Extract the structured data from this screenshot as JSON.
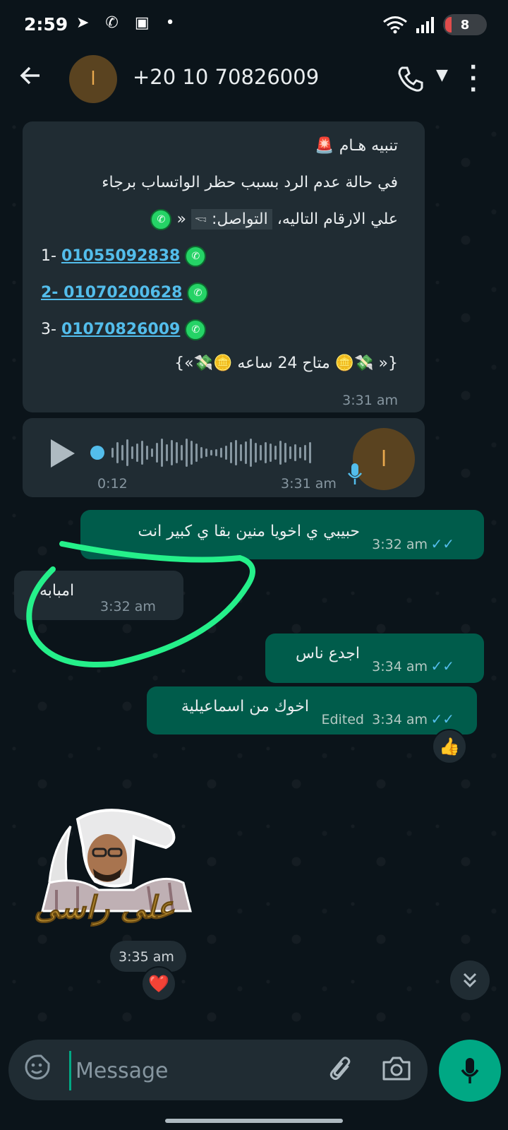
{
  "status_bar": {
    "time": "2:59",
    "icons": "➤ ✆ ▣ •",
    "battery": "8"
  },
  "header": {
    "back_icon": "arrow-left-icon",
    "avatar_letter": "ا",
    "contact": "+20 10 70826009"
  },
  "messages": {
    "alert": {
      "line1": "تنبيه هـام 🚨",
      "line2": "في حالة عدم الرد بسبب حظر الواتساب برجاء",
      "line3_a": "علي الارقام التاليه،",
      "line3_b": "التواصل: 🖘",
      "line3_c": "«",
      "n1_prefix": "1-",
      "n1": "01055092838",
      "n2": "2- 01070200628",
      "n3_prefix": "3-",
      "n3": "01070826009",
      "line7": "{« 💸🪙 متاح 24 ساعه 🪙💸»}",
      "time": "3:31 am"
    },
    "voice": {
      "duration": "0:12",
      "time": "3:31 am",
      "avatar_letter": "ا"
    },
    "out1": {
      "text": "حبيبي ي اخويا منين بقا ي كبير انت",
      "time": "3:32 am",
      "ticks": "✓✓"
    },
    "in1": {
      "text": "امبابه",
      "time": "3:32 am"
    },
    "out2": {
      "text": "اجدع ناس",
      "time": "3:34 am",
      "ticks": "✓✓"
    },
    "out3": {
      "text": "اخوك من اسماعيلية",
      "edited": "Edited",
      "time": "3:34 am",
      "ticks": "✓✓",
      "reaction": "👍"
    },
    "sticker": {
      "caption": "على راسى",
      "time": "3:35 am",
      "reaction": "❤️"
    }
  },
  "input": {
    "placeholder": "Message"
  },
  "colors": {
    "background": "#0b141a",
    "incoming": "#202c33",
    "outgoing": "#005c4b",
    "accent": "#00a884",
    "link": "#53bdeb",
    "highlight_stroke": "#25f08a"
  }
}
